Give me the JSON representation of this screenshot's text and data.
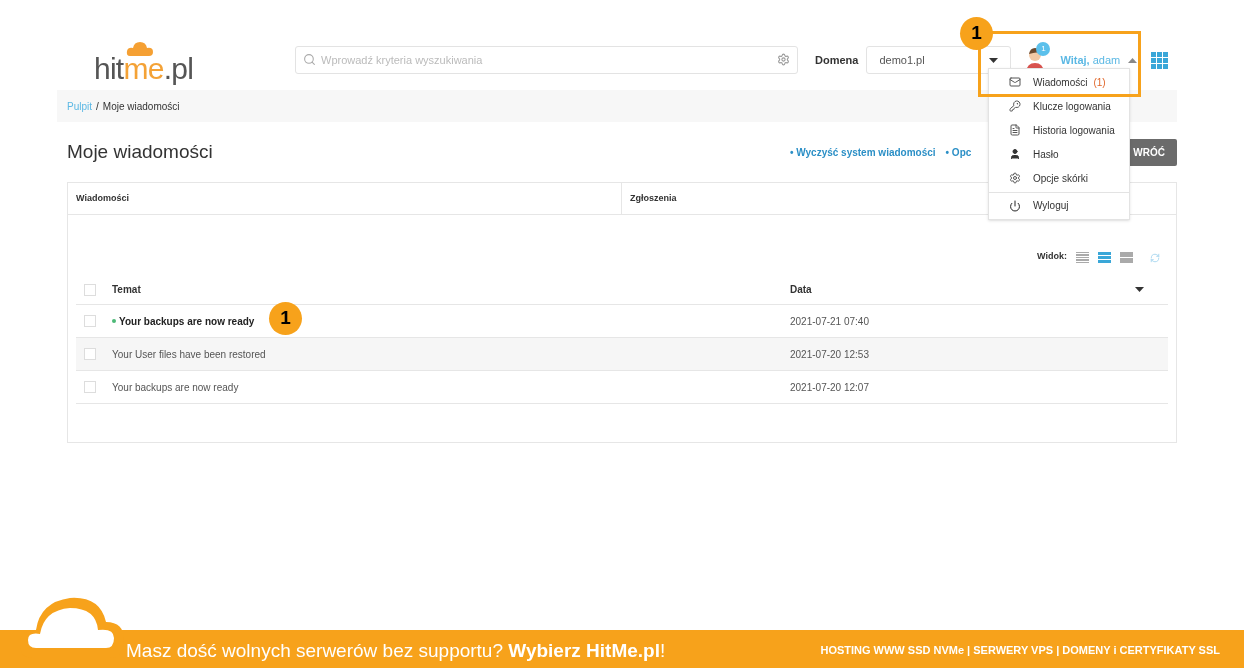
{
  "logo": {
    "dark": "hit",
    "accent": "me",
    "suffix": ".pl"
  },
  "search": {
    "placeholder": "Wprowadź kryteria wyszukiwania"
  },
  "domain": {
    "label": "Domena",
    "value": "demo1.pl"
  },
  "user": {
    "greeting": "Witaj,",
    "name": "adam",
    "badge": "1"
  },
  "menu": {
    "items": [
      {
        "kind": "envelope",
        "label": "Wiadomości",
        "count": "(1)"
      },
      {
        "kind": "key",
        "label": "Klucze logowania"
      },
      {
        "kind": "log",
        "label": "Historia logowania"
      },
      {
        "kind": "person",
        "label": "Hasło"
      },
      {
        "kind": "gear",
        "label": "Opcje skórki"
      },
      {
        "kind": "power",
        "label": "Wyloguj"
      }
    ]
  },
  "breadcrumb": {
    "link": "Pulpit",
    "separator": "/",
    "current": "Moje wiadomości"
  },
  "page_title": "Moje wiadomości",
  "actions": [
    "• Wyczyść system wiadomości",
    "• Opc"
  ],
  "back_button": "WRÓĆ",
  "tabs": [
    {
      "label": "Wiadomości"
    },
    {
      "label": "Zgłoszenia"
    }
  ],
  "view": {
    "label": "Widok:",
    "options": [
      {
        "selected": false
      },
      {
        "selected": true
      },
      {
        "selected": false
      }
    ]
  },
  "table": {
    "columns": [
      "Temat",
      "Data"
    ],
    "all_checked": false,
    "rows": [
      {
        "subject": "Your backups are now ready",
        "date": "2021-07-21 07:40",
        "unread": true,
        "checked": false
      },
      {
        "subject": "Your User files have been restored",
        "date": "2021-07-20 12:53",
        "unread": false,
        "checked": false
      },
      {
        "subject": "Your backups are now ready",
        "date": "2021-07-20 12:07",
        "unread": false,
        "checked": false
      }
    ]
  },
  "callouts": [
    "1",
    "1"
  ],
  "footer": {
    "slogan": "Masz dość wolnych serwerów bez supportu? **Wybierz HitMe.pl**!",
    "links": "HOSTING WWW SSD NVMe | SERWERY VPS | DOMENY i CERTYFIKATY SSL"
  }
}
